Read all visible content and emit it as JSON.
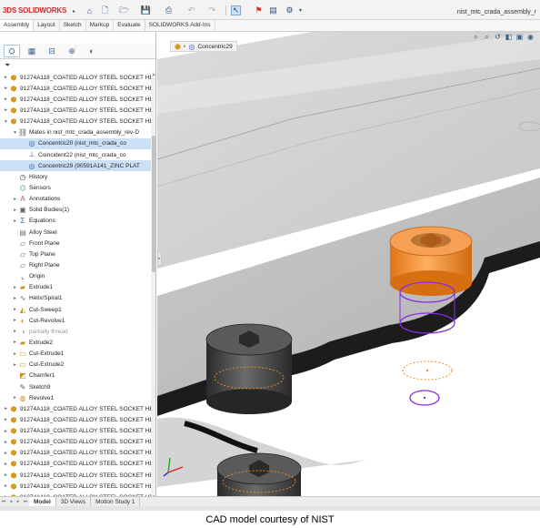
{
  "app": {
    "logo_text": "SOLIDWORKS",
    "logo_prefix": "3DS",
    "document_title": "nist_mtc_crada_assembly_r"
  },
  "command_tabs": [
    {
      "label": "Assembly"
    },
    {
      "label": "Layout"
    },
    {
      "label": "Sketch"
    },
    {
      "label": "Markup"
    },
    {
      "label": "Evaluate"
    },
    {
      "label": "SOLIDWORKS Add-Ins"
    }
  ],
  "breadcrumb": {
    "label": "Concentric29"
  },
  "tree": {
    "rows": [
      {
        "label": "91274A118_COATED ALLOY STEEL SOCKET HE",
        "icon": "part-icon",
        "exp": "▸",
        "depth": 0
      },
      {
        "label": "91274A118_COATED ALLOY STEEL SOCKET HE",
        "icon": "part-icon",
        "exp": "▸",
        "depth": 0
      },
      {
        "label": "91274A118_COATED ALLOY STEEL SOCKET HE",
        "icon": "part-icon",
        "exp": "▸",
        "depth": 0
      },
      {
        "label": "91274A118_COATED ALLOY STEEL SOCKET HE",
        "icon": "part-icon",
        "exp": "▸",
        "depth": 0
      },
      {
        "label": "91274A118_COATED ALLOY STEEL SOCKET HE",
        "icon": "part-icon",
        "exp": "▾",
        "depth": 0
      },
      {
        "label": "Mates in nist_mtc_crada_assembly_rev-D",
        "icon": "mates-icon",
        "exp": "▾",
        "depth": 1
      },
      {
        "label": "Concentric20 (nist_mtc_crada_co",
        "icon": "concentric-icon",
        "exp": "",
        "depth": 2,
        "selected": true
      },
      {
        "label": "Coincident22 (nist_mtc_crada_co",
        "icon": "coincident-icon",
        "exp": "",
        "depth": 2
      },
      {
        "label": "Concentric29 (90591A141_ZINC PLAT",
        "icon": "concentric-icon",
        "exp": "",
        "depth": 2,
        "selected": true
      },
      {
        "label": "History",
        "icon": "history-icon",
        "exp": "",
        "depth": 1
      },
      {
        "label": "Sensors",
        "icon": "sensor-icon",
        "exp": "",
        "depth": 1
      },
      {
        "label": "Annotations",
        "icon": "annotations-icon",
        "exp": "▸",
        "depth": 1
      },
      {
        "label": "Solid Bodies(1)",
        "icon": "solid-bodies-icon",
        "exp": "▸",
        "depth": 1
      },
      {
        "label": "Equations",
        "icon": "equations-icon",
        "exp": "▸",
        "depth": 1
      },
      {
        "label": "Alloy Steel",
        "icon": "material-icon",
        "exp": "",
        "depth": 1
      },
      {
        "label": "Front Plane",
        "icon": "plane-icon",
        "exp": "",
        "depth": 1
      },
      {
        "label": "Top Plane",
        "icon": "plane-icon",
        "exp": "",
        "depth": 1
      },
      {
        "label": "Right Plane",
        "icon": "plane-icon",
        "exp": "",
        "depth": 1
      },
      {
        "label": "Origin",
        "icon": "origin-icon",
        "exp": "",
        "depth": 1
      },
      {
        "label": "Extrude1",
        "icon": "extrude-icon",
        "exp": "▸",
        "depth": 1
      },
      {
        "label": "Helix/Spiral1",
        "icon": "helix-icon",
        "exp": "▸",
        "depth": 1
      },
      {
        "label": "Cut-Sweep1",
        "icon": "cut-sweep-icon",
        "exp": "▸",
        "depth": 1
      },
      {
        "label": "Cut-Revolve1",
        "icon": "cut-revolve-icon",
        "exp": "▸",
        "depth": 1
      },
      {
        "label": "partially thread",
        "icon": "thread-icon",
        "exp": "▸",
        "depth": 1,
        "dim": true
      },
      {
        "label": "Extrude2",
        "icon": "extrude-icon",
        "exp": "▸",
        "depth": 1
      },
      {
        "label": "Cut-Extrude1",
        "icon": "cut-extrude-icon",
        "exp": "▸",
        "depth": 1
      },
      {
        "label": "Cut-Extrude2",
        "icon": "cut-extrude-icon",
        "exp": "▸",
        "depth": 1
      },
      {
        "label": "Chamfer1",
        "icon": "chamfer-icon",
        "exp": "",
        "depth": 1
      },
      {
        "label": "Sketch9",
        "icon": "sketch-icon",
        "exp": "",
        "depth": 1
      },
      {
        "label": "Revolve1",
        "icon": "revolve-icon",
        "exp": "▸",
        "depth": 1
      },
      {
        "label": "91274A118_COATED ALLOY STEEL SOCKET HE",
        "icon": "part-icon",
        "exp": "▸",
        "depth": 0
      },
      {
        "label": "91274A118_COATED ALLOY STEEL SOCKET HE",
        "icon": "part-icon",
        "exp": "▸",
        "depth": 0
      },
      {
        "label": "91274A118_COATED ALLOY STEEL SOCKET HE",
        "icon": "part-icon",
        "exp": "▸",
        "depth": 0
      },
      {
        "label": "91274A118_COATED ALLOY STEEL SOCKET HE",
        "icon": "part-icon",
        "exp": "▸",
        "depth": 0
      },
      {
        "label": "91274A118_COATED ALLOY STEEL SOCKET HE",
        "icon": "part-icon",
        "exp": "▸",
        "depth": 0
      },
      {
        "label": "91274A118_COATED ALLOY STEEL SOCKET HE",
        "icon": "part-icon",
        "exp": "▸",
        "depth": 0
      },
      {
        "label": "91274A118_COATED ALLOY STEEL SOCKET HE",
        "icon": "part-icon",
        "exp": "▸",
        "depth": 0
      },
      {
        "label": "91274A118_COATED ALLOY STEEL SOCKET HE",
        "icon": "part-icon",
        "exp": "▸",
        "depth": 0
      },
      {
        "label": "91274A118_COATED ALLOY STEEL SOCKET HE",
        "icon": "part-icon",
        "exp": "▸",
        "depth": 0
      }
    ]
  },
  "bottom_tabs": [
    {
      "label": "Model",
      "active": true
    },
    {
      "label": "3D Views"
    },
    {
      "label": "Motion Study 1"
    }
  ],
  "caption": "CAD model courtesy of NIST",
  "colors": {
    "selected_bolt": "#f08a24",
    "mate_circle": "#8a2be2",
    "selection_highlight": "#cce0f6",
    "logo_red": "#d0282b"
  }
}
